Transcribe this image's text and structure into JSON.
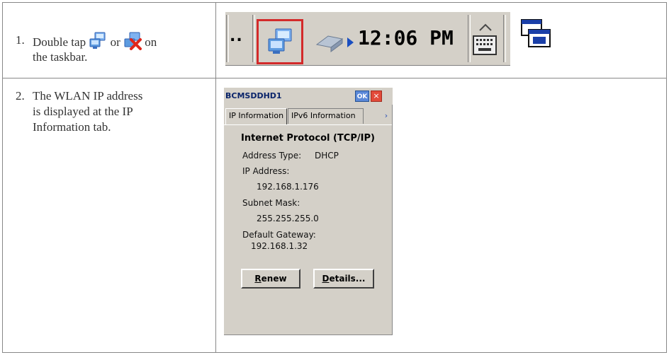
{
  "steps": [
    {
      "number": "1.",
      "text_prefix": "Double tap",
      "text_or": "or",
      "text_on": "on",
      "text_suffix": "the taskbar.",
      "icons": [
        "network-connected-icon",
        "network-disconnected-icon"
      ]
    },
    {
      "number": "2.",
      "line1": "The WLAN IP address",
      "line2": "is displayed at the IP",
      "line3": "Information tab."
    }
  ],
  "taskbar": {
    "overflow_label": "..",
    "time": "12:06 PM",
    "icons": [
      "network-connected-icon",
      "network-adapter-icon",
      "keyboard-icon",
      "windows-switch-icon"
    ]
  },
  "dialog": {
    "title": "BCMSDDHD1",
    "ok_label": "OK",
    "close_label": "×",
    "tabs": [
      "IP Information",
      "IPv6 Information"
    ],
    "tab_scroll_label": "›",
    "section_title": "Internet Protocol (TCP/IP)",
    "address_type_label": "Address Type:",
    "address_type_value": "DHCP",
    "ip_label": "IP Address:",
    "ip_value": "192.168.1.176",
    "subnet_label": "Subnet Mask:",
    "subnet_value": "255.255.255.0",
    "gateway_label": "Default Gateway:",
    "gateway_value": "192.168.1.32",
    "renew_underlined": "R",
    "renew_rest": "enew",
    "details_underlined": "D",
    "details_rest": "etails..."
  },
  "colors": {
    "highlight_border": "#d32a2a",
    "dialog_bg": "#d4d0c8",
    "title_text": "#0a246a"
  }
}
